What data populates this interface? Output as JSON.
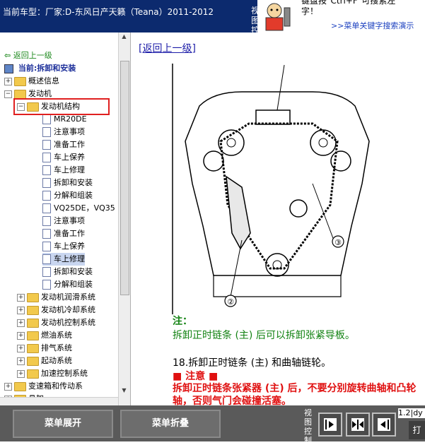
{
  "header": {
    "title": "当前车型：厂家:D-东风日产天籁（Teana）2011-2012",
    "view_control": "视图控"
  },
  "ad": {
    "tip_line1": "键盘按\"Ctrl+F\"可搜索左",
    "tip_line2": "字！",
    "link": ">>菜单关键字搜索演示"
  },
  "tree": {
    "back_label": "返回上一级",
    "current_label": "当前:拆卸和安装",
    "items": [
      {
        "label": "概述信息"
      },
      {
        "label": "发动机"
      },
      {
        "label": "发动机结构"
      },
      {
        "label": "MR20DE"
      },
      {
        "label": "注意事项"
      },
      {
        "label": "准备工作"
      },
      {
        "label": "车上保养"
      },
      {
        "label": "车上修理"
      },
      {
        "label": "拆卸和安装"
      },
      {
        "label": "分解和组装"
      },
      {
        "label": "VQ25DE，VQ35"
      },
      {
        "label": "注意事项"
      },
      {
        "label": "准备工作"
      },
      {
        "label": "车上保养"
      },
      {
        "label": "车上修理"
      },
      {
        "label": "拆卸和安装"
      },
      {
        "label": "分解和组装"
      },
      {
        "label": "发动机润滑系统"
      },
      {
        "label": "发动机冷却系统"
      },
      {
        "label": "发动机控制系统"
      },
      {
        "label": "燃油系统"
      },
      {
        "label": "排气系统"
      },
      {
        "label": "起动系统"
      },
      {
        "label": "加速控制系统"
      },
      {
        "label": "变速箱和传动系"
      },
      {
        "label": "悬架"
      }
    ]
  },
  "main": {
    "back_link": "[返回上一级]",
    "figure_callouts": [
      "②",
      "③"
    ],
    "note_heading": "注：",
    "note_text": "拆卸正时链条 (主) 后可以拆卸张紧导板。",
    "step_text": "18.拆卸正时链条 (主) 和曲轴链轮。",
    "caution_heading": "■ 注意 ■",
    "caution_text": "拆卸正时链条张紧器 (主) 后，不要分别旋转曲轴和凸轮轴，否则气门会碰撞活塞。"
  },
  "footer": {
    "expand_label": "菜单展开",
    "collapse_label": "菜单折叠",
    "view_control": "视图控制",
    "page_label": "1.2|dy",
    "print_label": "打"
  },
  "colors": {
    "header_bg": "#0c2a6e",
    "footer_bg": "#5a5a5a",
    "link": "#1c1ca8",
    "note_green": "#128212",
    "caution_red": "#e01010",
    "highlight_red": "#e02020"
  }
}
